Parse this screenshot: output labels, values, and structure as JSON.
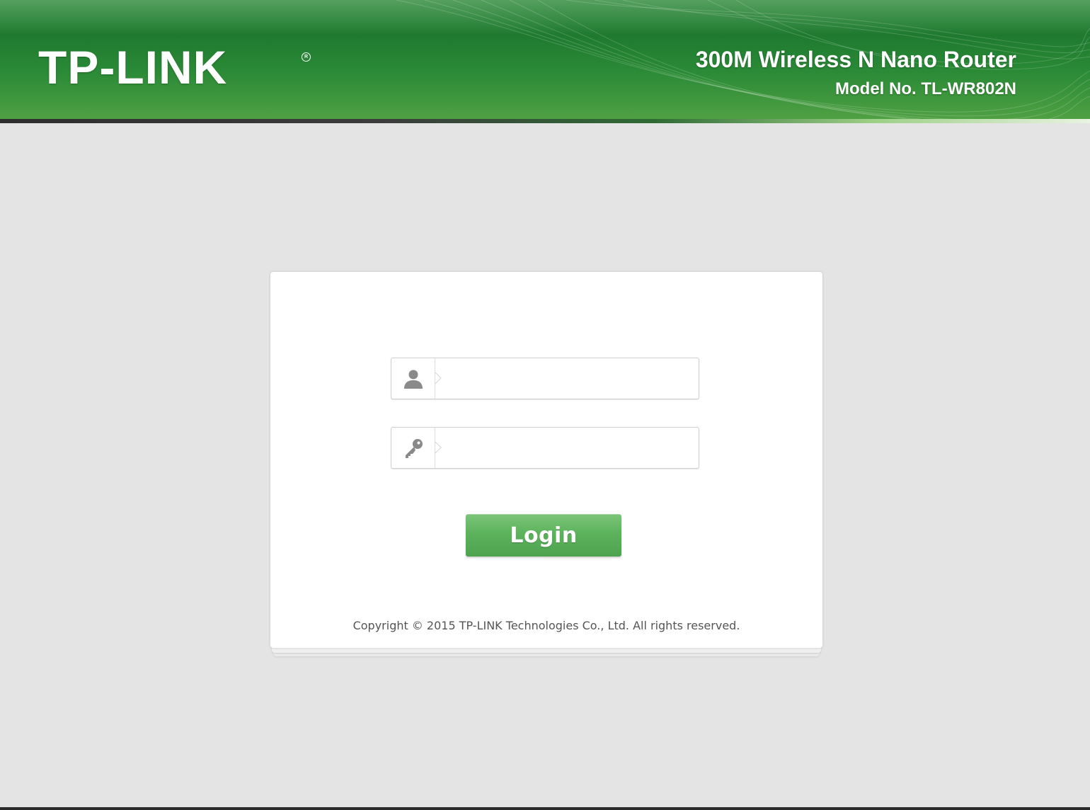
{
  "header": {
    "brand": "TP-LINK",
    "product_name": "300M Wireless N Nano Router",
    "model_number": "Model No. TL-WR802N"
  },
  "login_form": {
    "username": {
      "icon": "user-icon",
      "value": ""
    },
    "password": {
      "icon": "key-icon",
      "value": ""
    },
    "login_label": "Login"
  },
  "footer": {
    "copyright": "Copyright © 2015 TP-LINK Technologies Co., Ltd. All rights reserved."
  },
  "colors": {
    "header_green": "#2a8a36",
    "button_green": "#5cb35c",
    "background": "#e4e4e4"
  }
}
